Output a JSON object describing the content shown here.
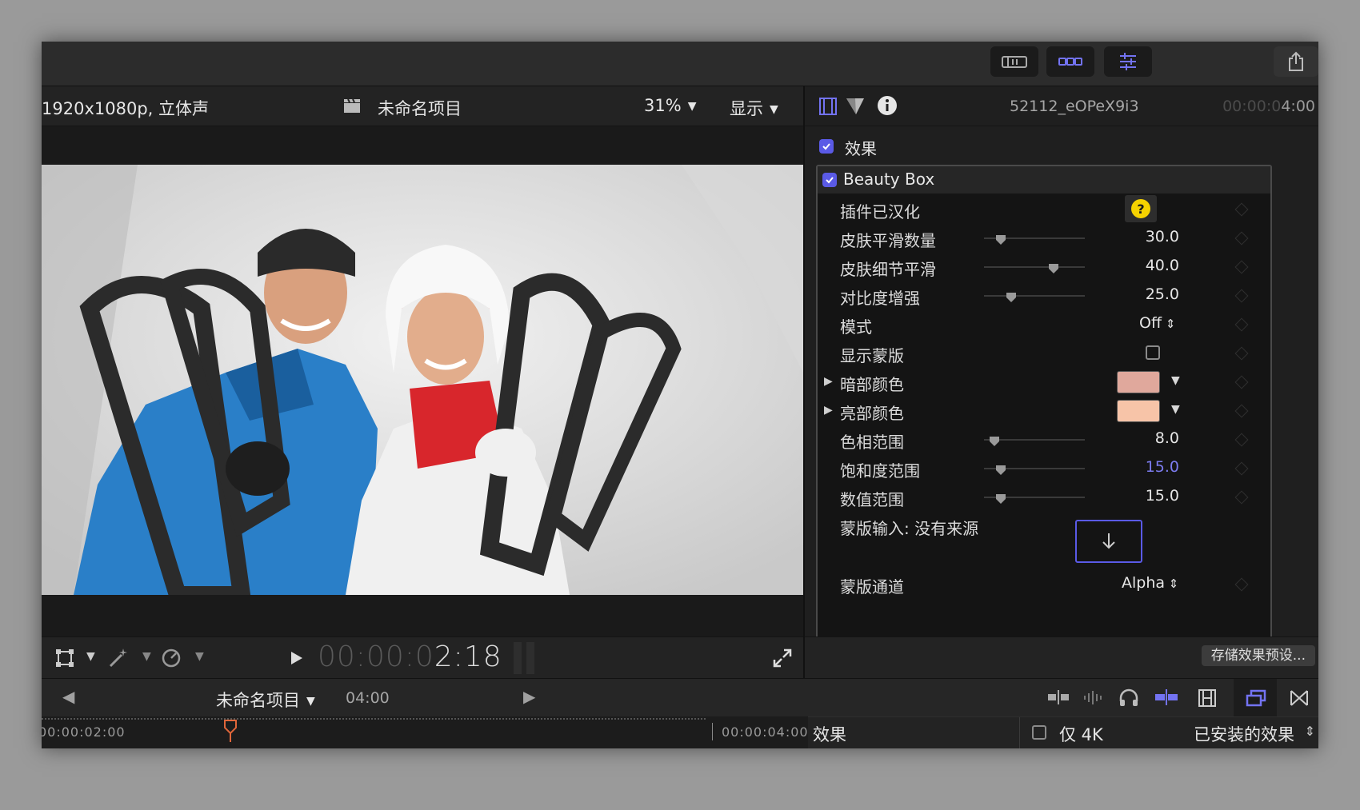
{
  "viewer": {
    "format": "1920x1080p, 立体声",
    "project_title": "未命名项目",
    "zoom": "31%",
    "show_menu": "显示"
  },
  "transport": {
    "timecode_dim": "00:00:0",
    "timecode_active": "2:18"
  },
  "inspector": {
    "clip_name": "52112_eOPeX9i3",
    "duration_dim": "00:00:0",
    "duration_active": "4:00",
    "effects_label": "效果",
    "effect_name": "Beauty Box",
    "params": [
      {
        "name": "插件已汉化",
        "kind": "help"
      },
      {
        "name": "皮肤平滑数量",
        "kind": "slider",
        "value": "30.0",
        "pos": 0.17
      },
      {
        "name": "皮肤细节平滑",
        "kind": "slider",
        "value": "40.0",
        "pos": 0.69
      },
      {
        "name": "对比度增强",
        "kind": "slider",
        "value": "25.0",
        "pos": 0.27
      },
      {
        "name": "模式",
        "kind": "popup",
        "value": "Off"
      },
      {
        "name": "显示蒙版",
        "kind": "checkbox"
      },
      {
        "name": "暗部颜色",
        "kind": "color",
        "color": "#e0a89c"
      },
      {
        "name": "亮部颜色",
        "kind": "color",
        "color": "#f7c4a8"
      },
      {
        "name": "色相范围",
        "kind": "slider",
        "value": "8.0",
        "pos": 0.1
      },
      {
        "name": "饱和度范围",
        "kind": "slider",
        "value": "15.0",
        "pos": 0.17,
        "accent": true
      },
      {
        "name": "数值范围",
        "kind": "slider",
        "value": "15.0",
        "pos": 0.17
      },
      {
        "name": "蒙版输入: 没有来源",
        "kind": "source"
      },
      {
        "name": "蒙版通道",
        "kind": "popup",
        "value": "Alpha"
      }
    ],
    "save_button": "存储效果预设..."
  },
  "timeline": {
    "project_name": "未命名项目",
    "project_duration": "04:00",
    "ruler_start": "00:00:02:00",
    "ruler_end": "00:00:04:00"
  },
  "effects_browser": {
    "title": "效果",
    "only_4k": "仅 4K",
    "installed": "已安装的效果"
  },
  "colors": {
    "accent": "#5a5ae6",
    "playhead": "#e0663a",
    "help_icon": "#f6d200"
  }
}
